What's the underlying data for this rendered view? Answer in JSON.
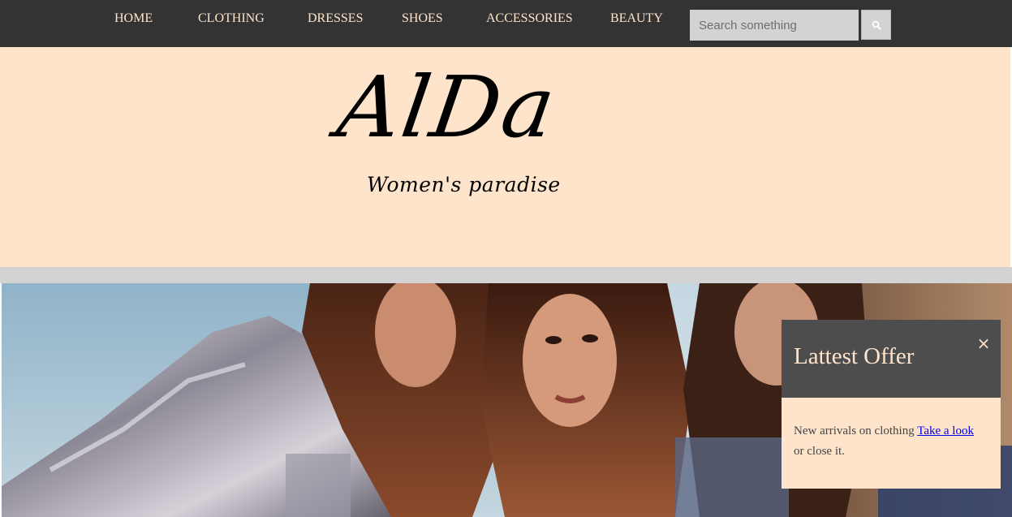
{
  "nav": {
    "items": [
      {
        "label": "HOME"
      },
      {
        "label": "CLOTHING"
      },
      {
        "label": "DRESSES"
      },
      {
        "label": "SHOES"
      },
      {
        "label": "ACCESSORIES"
      },
      {
        "label": "BEAUTY"
      }
    ]
  },
  "search": {
    "placeholder": "Search something",
    "value": "",
    "icon": "search-icon"
  },
  "header": {
    "logo_title": "AlDa",
    "logo_tagline": "Women's paradise"
  },
  "offer": {
    "title": "Lattest Offer",
    "close_symbol": "×",
    "text_before": "New arrivals on clothing ",
    "link_text": "Take a look",
    "text_after": " or close it."
  },
  "colors": {
    "nav_bg": "#333333",
    "nav_text": "#ffe4cc",
    "header_bg": "#ffe4cc",
    "band": "#d3d3d3",
    "popup_head": "#4d4d4d",
    "link": "#0000ee"
  }
}
